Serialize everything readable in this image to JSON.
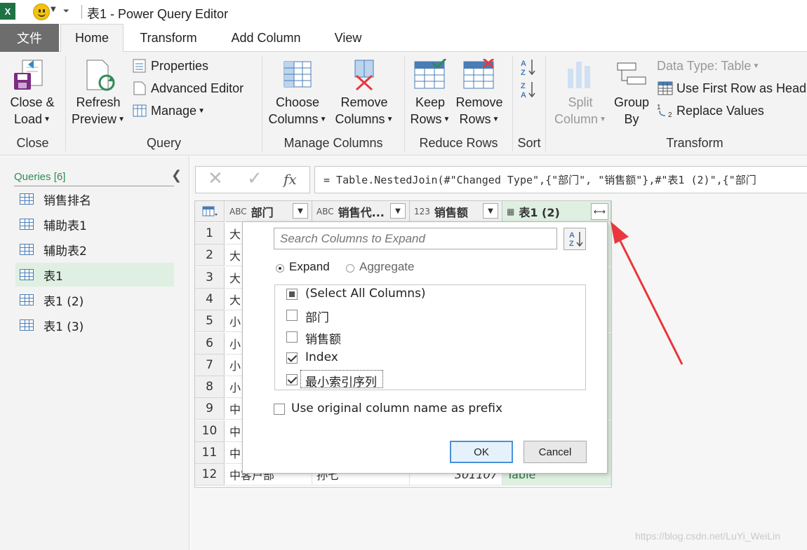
{
  "titlebar": {
    "title": "表1 - Power Query Editor",
    "excel_glyph": "X"
  },
  "tabs": {
    "file": "文件",
    "home": "Home",
    "transform": "Transform",
    "add_column": "Add Column",
    "view": "View"
  },
  "ribbon": {
    "close_load_1": "Close &",
    "close_load_2": "Load",
    "refresh_1": "Refresh",
    "refresh_2": "Preview",
    "properties": "Properties",
    "advanced_editor": "Advanced Editor",
    "manage": "Manage",
    "choose_1": "Choose",
    "choose_2": "Columns",
    "remove_1": "Remove",
    "remove_2": "Columns",
    "keep_1": "Keep",
    "keep_2": "Rows",
    "remove_rows_1": "Remove",
    "remove_rows_2": "Rows",
    "split_1": "Split",
    "split_2": "Column",
    "group_1": "Group",
    "group_2": "By",
    "data_type": "Data Type: Table",
    "first_row": "Use First Row as Head",
    "replace_values": "Replace Values",
    "groups": {
      "close": "Close",
      "query": "Query",
      "manage_columns": "Manage Columns",
      "reduce_rows": "Reduce Rows",
      "sort": "Sort",
      "transform": "Transform"
    }
  },
  "queries": {
    "header": "Queries [6]",
    "items": [
      "销售排名",
      "辅助表1",
      "辅助表2",
      "表1",
      "表1 (2)",
      "表1 (3)"
    ]
  },
  "formula": {
    "fx": "fx",
    "text": "= Table.NestedJoin(#\"Changed Type\",{\"部门\", \"销售额\"},#\"表1 (2)\",{\"部门"
  },
  "grid": {
    "columns": [
      {
        "type": "ABC",
        "name": "部门"
      },
      {
        "type": "ABC",
        "name": "销售代..."
      },
      {
        "type": "123",
        "name": "销售额"
      },
      {
        "type": "table",
        "name": "表1 (2)"
      }
    ],
    "row_numbers": [
      "1",
      "2",
      "3",
      "4",
      "5",
      "6",
      "7",
      "8",
      "9",
      "10",
      "11",
      "12"
    ],
    "col1_prefix": [
      "大",
      "大",
      "大",
      "大",
      "小",
      "小",
      "小",
      "小",
      "中",
      "中",
      "中"
    ],
    "last_row": {
      "dept": "中客户部",
      "rep": "孙七",
      "sales": "301107",
      "table": "Table"
    }
  },
  "popup": {
    "search_placeholder": "Search Columns to Expand",
    "expand_label": "Expand",
    "aggregate_label": "Aggregate",
    "select_all": "(Select All Columns)",
    "columns": [
      {
        "name": "部门",
        "checked": false
      },
      {
        "name": "销售额",
        "checked": false
      },
      {
        "name": "Index",
        "checked": true
      },
      {
        "name": "最小索引序列",
        "checked": true
      }
    ],
    "prefix_label": "Use original column name as prefix",
    "ok": "OK",
    "cancel": "Cancel"
  },
  "watermark": "https://blog.csdn.net/LuYi_WeiLin",
  "colors": {
    "accent_green": "#2e8b57",
    "active_bg": "#dff0e2",
    "arrow_red": "#e8383d"
  }
}
